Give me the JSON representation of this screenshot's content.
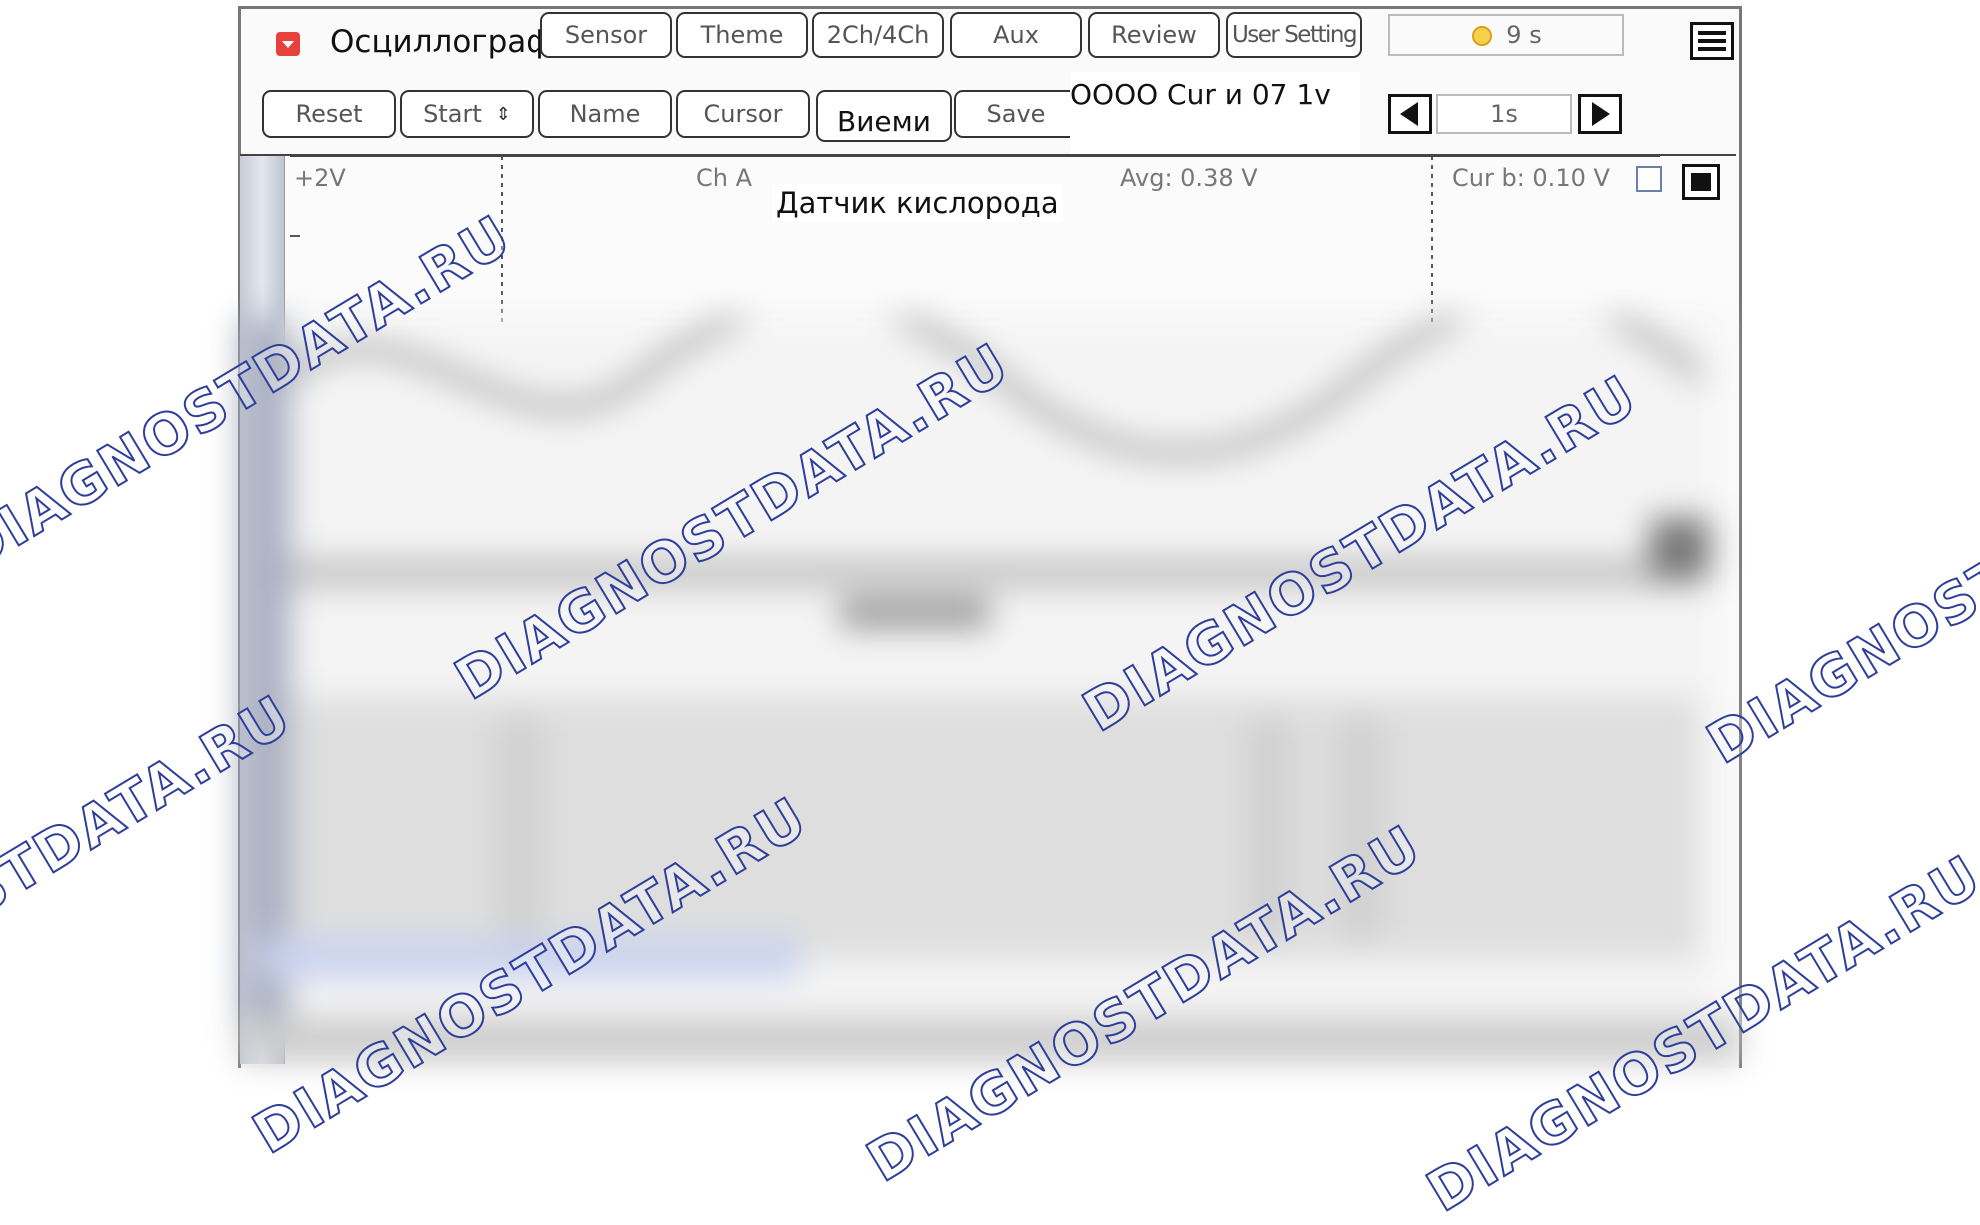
{
  "app": {
    "title": "Осциллограф",
    "menu_icon": "hamburger-menu-icon",
    "app_icon": "dropdown-icon"
  },
  "toolbar_top": {
    "buttons": [
      "Sensor",
      "Theme",
      "2Ch/4Ch",
      "Aux",
      "Review",
      "User Setting"
    ],
    "timer": "9 s"
  },
  "toolbar_bottom": {
    "buttons": [
      "Reset",
      "Start",
      "Name",
      "Cursor",
      "Виеми",
      "Save"
    ],
    "cursor_readout": "OOOO Cur и 07 1v",
    "step_value": "1s"
  },
  "plot": {
    "voltage_label": "+2V",
    "channel": "Ch A",
    "sensor_title": "Датчик кислорода",
    "avg_label": "Avg: 0.38 V",
    "cur_b_label": "Cur b: 0.10 V"
  },
  "watermark": "DIAGNOSTDATA.RU",
  "colors": {
    "watermark_stroke": "#2e3f9a",
    "app_icon": "#e8413c",
    "timer_icon": "#f5d14a"
  }
}
